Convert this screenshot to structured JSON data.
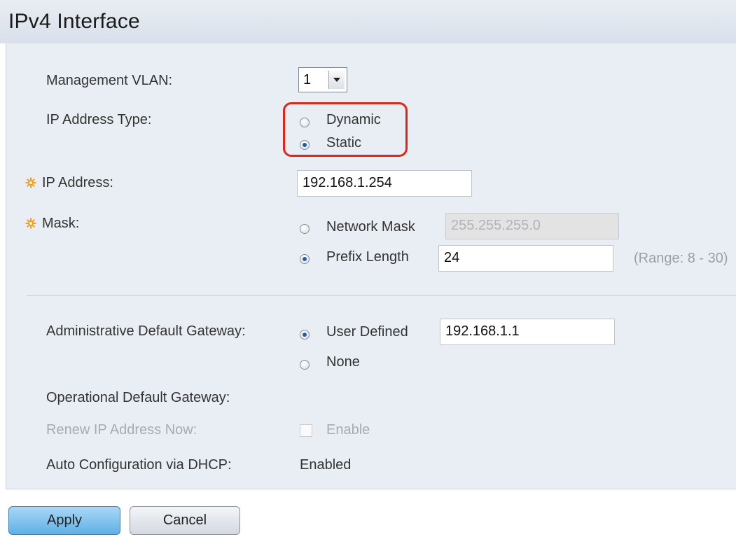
{
  "page": {
    "title": "IPv4 Interface"
  },
  "form": {
    "management_vlan": {
      "label": "Management VLAN:",
      "value": "1"
    },
    "ip_address_type": {
      "label": "IP Address Type:",
      "options": [
        "Dynamic",
        "Static"
      ],
      "selected": "Static"
    },
    "ip_address": {
      "label": "IP Address:",
      "value": "192.168.1.254"
    },
    "mask": {
      "label": "Mask:",
      "network_mask_label": "Network Mask",
      "network_mask_value": "255.255.255.0",
      "prefix_length_label": "Prefix Length",
      "prefix_length_value": "24",
      "range_hint": "(Range: 8 - 30)",
      "selected": "Prefix Length"
    },
    "admin_gateway": {
      "label": "Administrative Default Gateway:",
      "user_defined_label": "User Defined",
      "user_defined_value": "192.168.1.1",
      "none_label": "None",
      "selected": "User Defined"
    },
    "operational_gateway": {
      "label": "Operational Default Gateway:"
    },
    "renew_ip": {
      "label": "Renew IP Address Now:",
      "checkbox_label": "Enable"
    },
    "auto_config": {
      "label": "Auto Configuration via DHCP:",
      "value": "Enabled"
    }
  },
  "buttons": {
    "apply": "Apply",
    "cancel": "Cancel"
  },
  "colors": {
    "accent": "#1d5fa8",
    "highlight": "#e0261b",
    "panel": "#e9eef5",
    "required_icon": "#f0a020"
  }
}
